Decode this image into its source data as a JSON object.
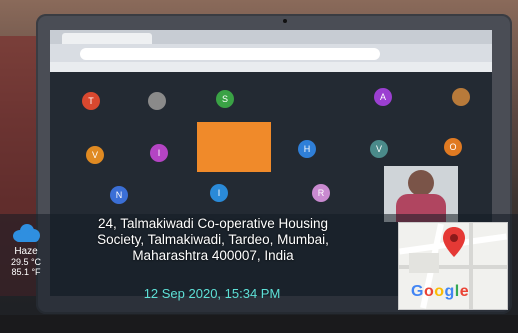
{
  "address": {
    "line1": "24, Talmakiwadi Co-operative Housing",
    "line2": "Society, Talmakiwadi, Tardeo, Mumbai,",
    "line3": "Maharashtra 400007, India"
  },
  "datetime": "12 Sep 2020, 15:34 PM",
  "weather": {
    "icon": "cloud-icon",
    "description": "Haze",
    "celsius": "29.5 °C",
    "fahrenheit": "85.1 °F"
  },
  "map": {
    "logo_text": "Google",
    "logo_colors": [
      "#4285F4",
      "#EA4335",
      "#FBBC05",
      "#4285F4",
      "#34A853",
      "#EA4335"
    ]
  },
  "participants": [
    {
      "initial": "T",
      "color": "#d9482f"
    },
    {
      "initial": "",
      "color": "#8a8a8a"
    },
    {
      "initial": "S",
      "color": "#3aa245"
    },
    {
      "initial": "A",
      "color": "#9b3fd1"
    },
    {
      "initial": "",
      "color": "#b87a3a"
    },
    {
      "initial": "V",
      "color": "#e08a22"
    },
    {
      "initial": "I",
      "color": "#b444c4"
    },
    {
      "initial": "H",
      "color": "#2f7fd8"
    },
    {
      "initial": "V",
      "color": "#4a8a8a"
    },
    {
      "initial": "O",
      "color": "#e07a22"
    },
    {
      "initial": "N",
      "color": "#3b6fd6"
    },
    {
      "initial": "I",
      "color": "#2a8ad8"
    },
    {
      "initial": "R",
      "color": "#c98ad0"
    }
  ]
}
